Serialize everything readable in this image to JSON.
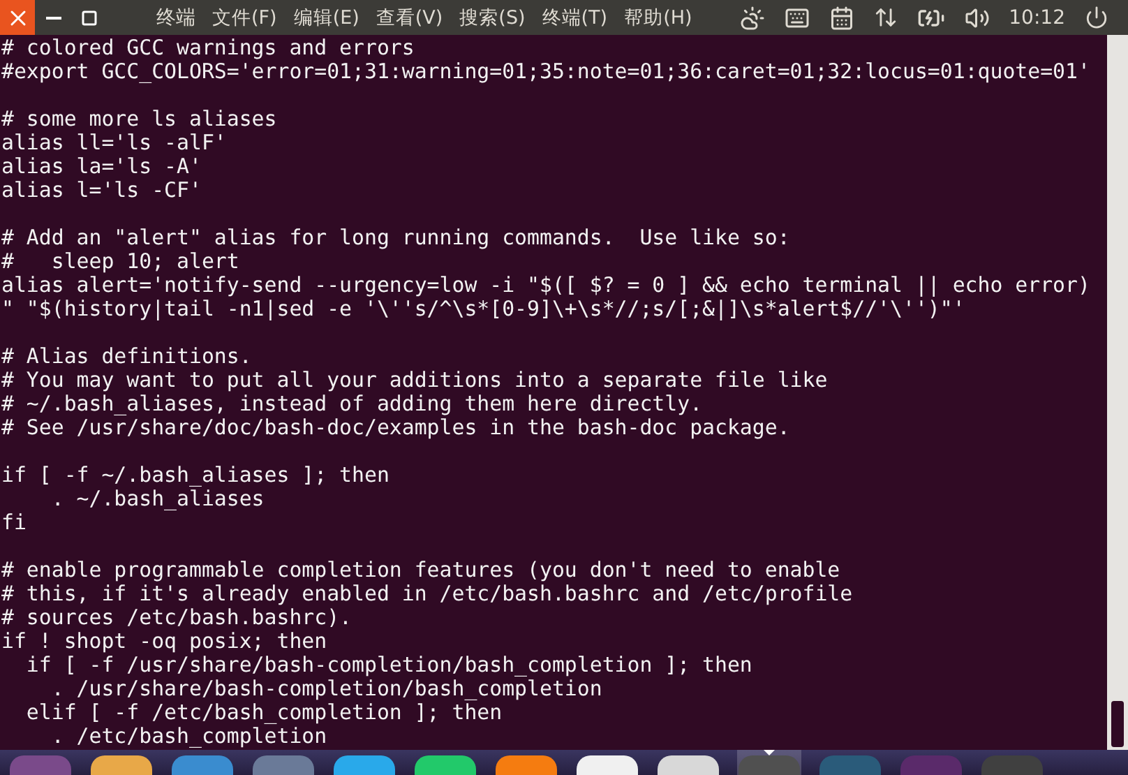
{
  "top_bar": {
    "app_name": "终端",
    "menus": [
      "文件(F)",
      "编辑(E)",
      "查看(V)",
      "搜索(S)",
      "终端(T)",
      "帮助(H)"
    ],
    "clock": "10:12"
  },
  "terminal": {
    "blocks": [
      [
        "# colored GCC warnings and errors",
        "#export GCC_COLORS='error=01;31:warning=01;35:note=01;36:caret=01;32:locus=01:quote=01'"
      ],
      [
        "# some more ls aliases",
        "alias ll='ls -alF'",
        "alias la='ls -A'",
        "alias l='ls -CF'"
      ],
      [
        "# Add an \"alert\" alias for long running commands.  Use like so:",
        "#   sleep 10; alert",
        "alias alert='notify-send --urgency=low -i \"$([ $? = 0 ] && echo terminal || echo error)",
        "\" \"$(history|tail -n1|sed -e '\\''s/^\\s*[0-9]\\+\\s*//;s/[;&|]\\s*alert$//'\\'')\"'"
      ],
      [
        "# Alias definitions.",
        "# You may want to put all your additions into a separate file like",
        "# ~/.bash_aliases, instead of adding them here directly.",
        "# See /usr/share/doc/bash-doc/examples in the bash-doc package."
      ],
      [
        "if [ -f ~/.bash_aliases ]; then",
        "    . ~/.bash_aliases",
        "fi"
      ],
      [
        "# enable programmable completion features (you don't need to enable",
        "# this, if it's already enabled in /etc/bash.bashrc and /etc/profile",
        "# sources /etc/bash.bashrc).",
        "if ! shopt -oq posix; then",
        "  if [ -f /usr/share/bash-completion/bash_completion ]; then",
        "    . /usr/share/bash-completion/bash_completion",
        "  elif [ -f /etc/bash_completion ]; then",
        "    . /etc/bash_completion"
      ]
    ]
  },
  "dock": [
    {
      "color": "#7a4a8a",
      "selected": false
    },
    {
      "color": "#e8a848",
      "selected": false
    },
    {
      "color": "#3a8ccf",
      "selected": false
    },
    {
      "color": "#6a7a98",
      "selected": false
    },
    {
      "color": "#29a9ea",
      "selected": false
    },
    {
      "color": "#22c96a",
      "selected": false
    },
    {
      "color": "#f57c10",
      "selected": false
    },
    {
      "color": "#f0f0f0",
      "selected": false
    },
    {
      "color": "#d8d8d8",
      "selected": false
    },
    {
      "color": "#505050",
      "selected": true
    },
    {
      "color": "#2a5b7a",
      "selected": false
    },
    {
      "color": "#5a2a6a",
      "selected": false
    },
    {
      "color": "#404040",
      "selected": false
    }
  ]
}
